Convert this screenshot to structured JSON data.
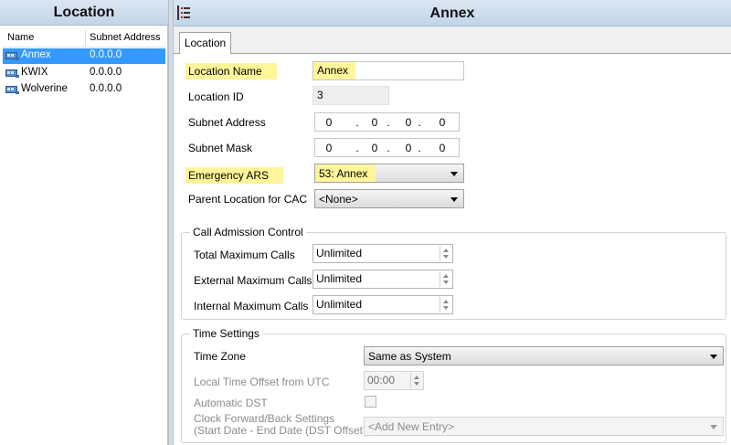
{
  "left": {
    "title": "Location",
    "columns": {
      "name": "Name",
      "subnet": "Subnet Address"
    },
    "rows": [
      {
        "name": "Annex",
        "subnet": "0.0.0.0",
        "selected": true
      },
      {
        "name": "KWIX",
        "subnet": "0.0.0.0",
        "selected": false
      },
      {
        "name": "Wolverine",
        "subnet": "0.0.0.0",
        "selected": false
      }
    ]
  },
  "right": {
    "title": "Annex",
    "tab": "Location",
    "form": {
      "location_name": {
        "label": "Location Name",
        "value": "Annex"
      },
      "location_id": {
        "label": "Location ID",
        "value": "3"
      },
      "subnet_address": {
        "label": "Subnet Address",
        "octets": [
          "0",
          "0",
          "0",
          "0"
        ]
      },
      "subnet_mask": {
        "label": "Subnet Mask",
        "octets": [
          "0",
          "0",
          "0",
          "0"
        ]
      },
      "emergency_ars": {
        "label": "Emergency ARS",
        "value": "53: Annex"
      },
      "parent_location": {
        "label": "Parent Location for CAC",
        "value": "<None>"
      }
    },
    "call_admission": {
      "title": "Call Admission Control",
      "total": {
        "label": "Total Maximum Calls",
        "value": "Unlimited"
      },
      "external": {
        "label": "External Maximum Calls",
        "value": "Unlimited"
      },
      "internal": {
        "label": "Internal Maximum Calls",
        "value": "Unlimited"
      }
    },
    "time_settings": {
      "title": "Time Settings",
      "time_zone": {
        "label": "Time Zone",
        "value": "Same as System"
      },
      "local_offset": {
        "label": "Local Time Offset from UTC",
        "value": "00:00"
      },
      "auto_dst": {
        "label": "Automatic DST",
        "checked": false
      },
      "clock_label_1": "Clock Forward/Back Settings",
      "clock_label_2": "(Start Date - End Date (DST Offset))",
      "clock_value": "<Add New Entry>"
    }
  },
  "colors": {
    "selection": "#3399ff",
    "highlight": "#fff59a",
    "header": "#c3d4e8"
  }
}
